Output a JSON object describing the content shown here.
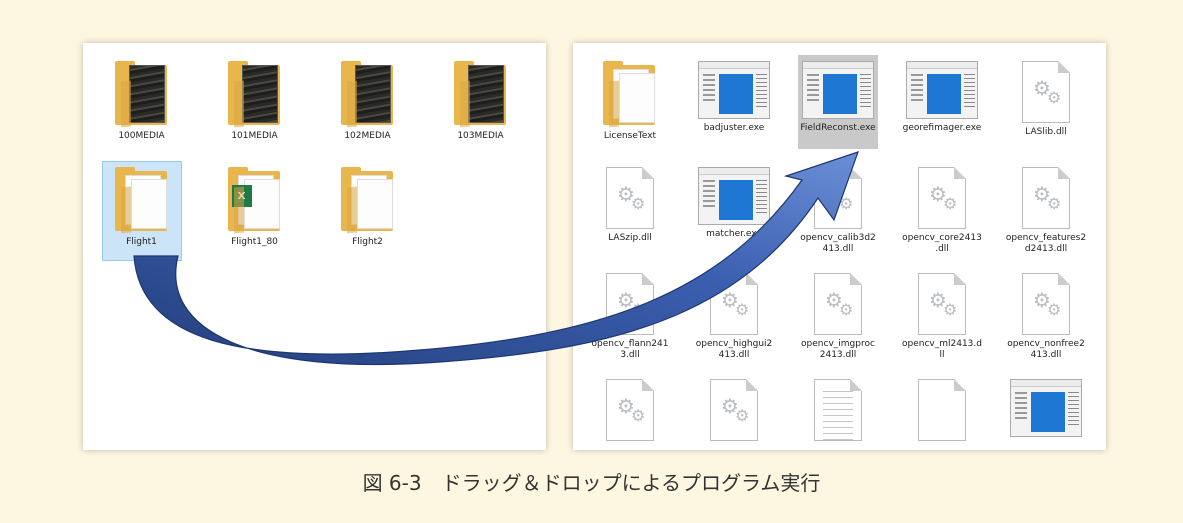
{
  "left_window": {
    "items": [
      {
        "label": "100MEDIA",
        "type": "folder-photo"
      },
      {
        "label": "101MEDIA",
        "type": "folder-photo"
      },
      {
        "label": "102MEDIA",
        "type": "folder-photo"
      },
      {
        "label": "103MEDIA",
        "type": "folder-photo"
      },
      {
        "label": "Flight1",
        "type": "folder",
        "selected": true
      },
      {
        "label": "Flight1_80",
        "type": "folder-excel"
      },
      {
        "label": "Flight2",
        "type": "folder"
      }
    ]
  },
  "right_window": {
    "items": [
      {
        "label": "LicenseText",
        "type": "folder"
      },
      {
        "label": "badjuster.exe",
        "type": "exe"
      },
      {
        "label": "FieldReconst.exe",
        "type": "exe",
        "highlighted": true
      },
      {
        "label": "georefimager.exe",
        "type": "exe"
      },
      {
        "label": "LASlib.dll",
        "type": "dll"
      },
      {
        "label": "LASzip.dll",
        "type": "dll"
      },
      {
        "label": "matcher.exe",
        "type": "exe"
      },
      {
        "label": "opencv_calib3d2\n413.dll",
        "type": "dll"
      },
      {
        "label": "opencv_core2413\n.dll",
        "type": "dll"
      },
      {
        "label": "opencv_features2\nd2413.dll",
        "type": "dll"
      },
      {
        "label": "opencv_flann241\n3.dll",
        "type": "dll"
      },
      {
        "label": "opencv_highgui2\n413.dll",
        "type": "dll"
      },
      {
        "label": "opencv_imgproc\n2413.dll",
        "type": "dll"
      },
      {
        "label": "opencv_ml2413.d\nll",
        "type": "dll"
      },
      {
        "label": "opencv_nonfree2\n413.dll",
        "type": "dll"
      },
      {
        "label": "",
        "type": "dll"
      },
      {
        "label": "",
        "type": "dll"
      },
      {
        "label": "",
        "type": "text-doc"
      },
      {
        "label": "",
        "type": "blank-doc"
      },
      {
        "label": "",
        "type": "exe"
      }
    ]
  },
  "caption": "図 6-3　ドラッグ＆ドロップによるプログラム実行",
  "colors": {
    "background": "#fdf7e1",
    "selection": "#cce4f7",
    "highlight": "#c9c9c9",
    "arrow": "#3a63b5",
    "exe_blue": "#1e78d3"
  },
  "icons": {
    "folder": "folder-icon",
    "exe": "application-window-icon",
    "dll": "gears-file-icon",
    "excel": "excel-icon",
    "arrow": "drag-arrow-icon"
  }
}
